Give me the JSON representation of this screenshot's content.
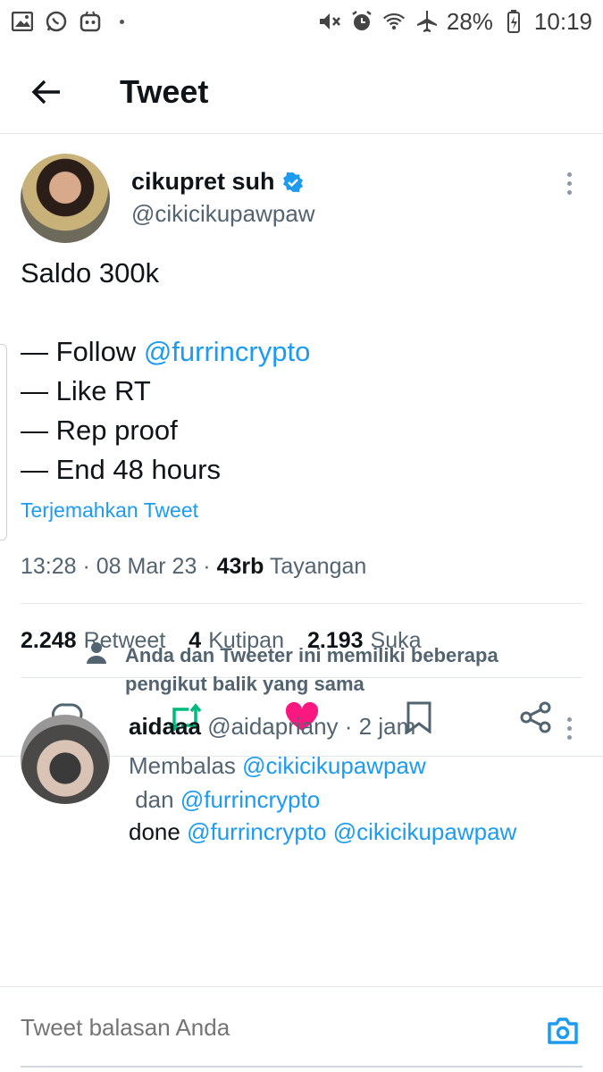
{
  "status_bar": {
    "battery": "28%",
    "time": "10:19",
    "left_icons": [
      "gallery-icon",
      "whatsapp-icon",
      "app-icon"
    ],
    "right_icons": [
      "mute-vibrate-icon",
      "alarm-icon",
      "wifi-icon",
      "airplane-icon",
      "battery-icon"
    ]
  },
  "header": {
    "title": "Tweet"
  },
  "tweet": {
    "author_name": "cikupret suh",
    "author_handle": "@cikicikupawpaw",
    "verified": true,
    "text_lines": [
      "Saldo 300k",
      "",
      "— Follow ",
      "— Like RT",
      "— Rep proof",
      "— End 48 hours"
    ],
    "mention": "@furrincrypto",
    "translate": "Terjemahkan Tweet",
    "time": "13:28",
    "date": "08 Mar 23",
    "views_count": "43rb",
    "views_label": "Tayangan",
    "stats": {
      "retweets": "2.248",
      "retweets_label": "Retweet",
      "quotes": "4",
      "quotes_label": "Kutipan",
      "likes": "2.193",
      "likes_label": "Suka"
    }
  },
  "social_context": "Anda dan Tweeter ini memiliki beberapa pengikut balik yang sama",
  "reply": {
    "name": "aidaaa",
    "handle": "@aidapriany",
    "time": "2 jam",
    "replying_prefix": "Membalas ",
    "replying_to_1": "@cikicikupawpaw",
    "replying_and": " dan ",
    "replying_to_2": "@furrincrypto",
    "text_prefix": "done ",
    "text_mention_1": "@furrincrypto",
    "text_mention_2": "@cikicikupawpaw"
  },
  "composer": {
    "placeholder": "Tweet balasan Anda"
  },
  "colors": {
    "accent": "#1d9bf0",
    "retweet_active": "#00ba7c",
    "like_active": "#f91880"
  }
}
